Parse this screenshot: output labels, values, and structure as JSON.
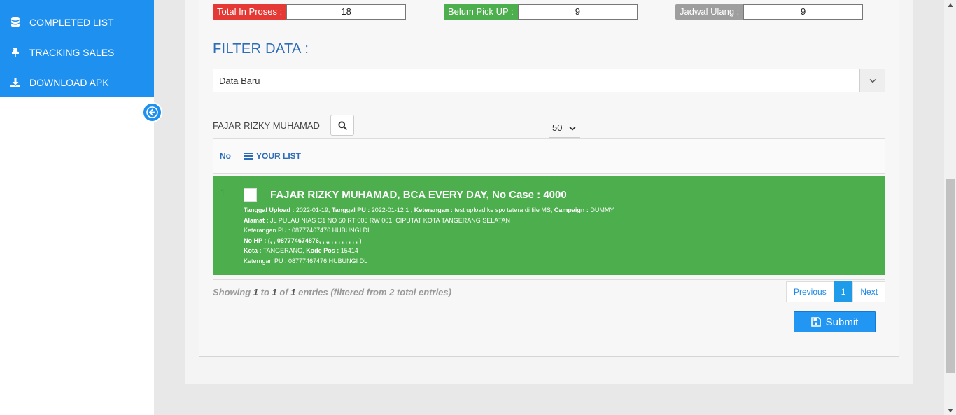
{
  "sidebar": {
    "items": [
      {
        "label": "COMPLETED LIST",
        "icon": "database-icon"
      },
      {
        "label": "TRACKING SALES",
        "icon": "pin-icon"
      },
      {
        "label": "DOWNLOAD APK",
        "icon": "download-icon"
      }
    ]
  },
  "stats": {
    "in_proses": {
      "label": "Total In Proses :",
      "value": "18",
      "color": "#e53935"
    },
    "belum_pickup": {
      "label": "Belum Pick UP :",
      "value": "9",
      "color": "#4cae4c"
    },
    "jadwal_ulang": {
      "label": "Jadwal Ulang :",
      "value": "9",
      "color": "#9e9e9e"
    }
  },
  "filter": {
    "title": "FILTER DATA :",
    "selected": "Data Baru"
  },
  "search": {
    "value": "FAJAR RIZKY MUHAMAD"
  },
  "page_length": "50",
  "table": {
    "col_no": "No",
    "col_list": "YOUR LIST"
  },
  "row": {
    "number": "1",
    "title": "FAJAR RIZKY MUHAMAD, BCA EVERY DAY, No Case : 4000",
    "line1_k1": "Tanggal Upload :",
    "line1_v1": " 2022-01-19, ",
    "line1_k2": "Tanggal PU :",
    "line1_v2": " 2022-01-12 1 , ",
    "line1_k3": "Keterangan :",
    "line1_v3": " test upload ke spv tetera di file MS, ",
    "line1_k4": "Campaign :",
    "line1_v4": " DUMMY",
    "line2_k": "Alamat :",
    "line2_v": " JL PULAU NIAS C1 NO 50 RT 005 RW 001, CIPUTAT KOTA TANGERANG SELATAN",
    "line3": "Keterangan PU : 08777467476 HUBUNGI DL",
    "line4": "No HP : (, , 087774674876, , ,, , , , , , , , , )",
    "line5_k1": "Kota :",
    "line5_v1": " TANGERANG, ",
    "line5_k2": "Kode Pos :",
    "line5_v2": " 15414",
    "line6": "Keterngan PU : 08777467476 HUBUNGI DL"
  },
  "info": {
    "prefix": "Showing ",
    "from": "1",
    "to_word": " to ",
    "to": "1",
    "of_word": " of ",
    "total": "1",
    "suffix": " entries (filtered from 2 total entries)"
  },
  "pagination": {
    "previous": "Previous",
    "current": "1",
    "next": "Next"
  },
  "submit_label": "Submit"
}
